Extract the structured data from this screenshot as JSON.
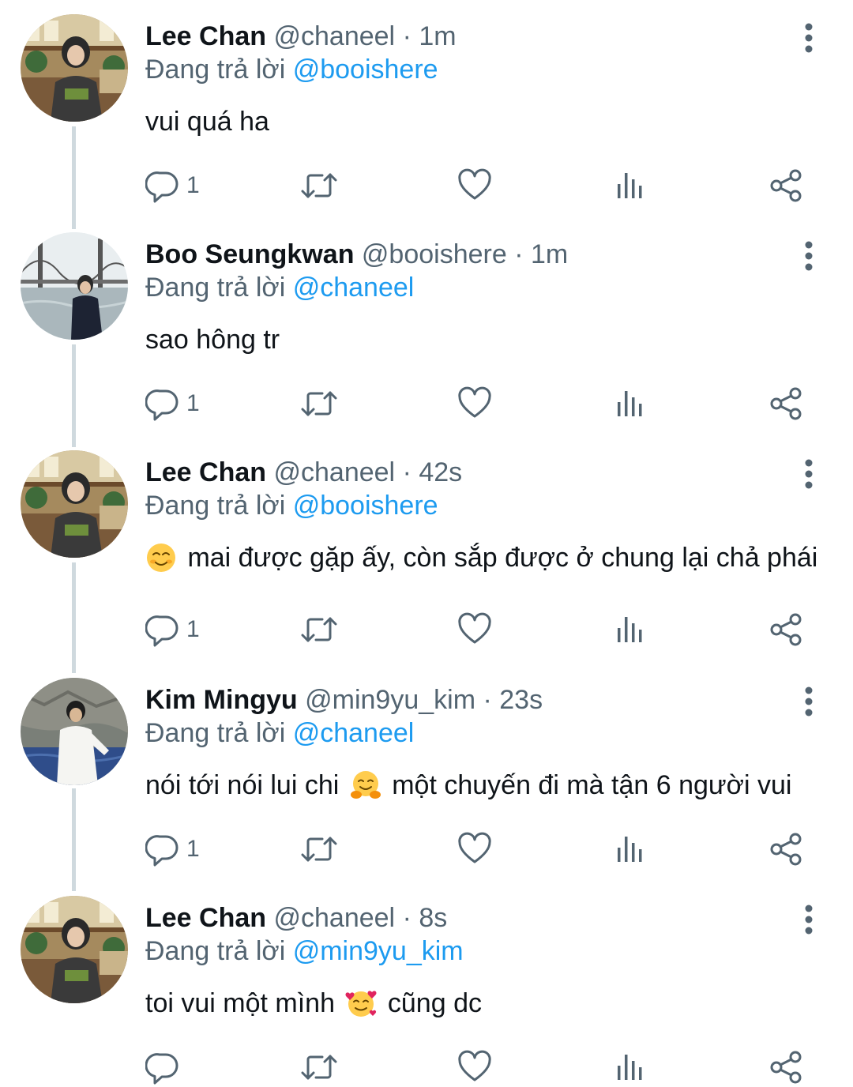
{
  "reply_prefix": "Đang trả lời",
  "separator": "·",
  "icons": {
    "reply": "reply-icon",
    "retweet": "retweet-icon",
    "like": "heart-icon",
    "stats": "stats-icon",
    "share": "share-icon",
    "more": "more-vertical-icon"
  },
  "colors": {
    "accent": "#1d9bf0",
    "secondary_text": "#536471",
    "thread_line": "#cfd9de"
  },
  "tweets": [
    {
      "name": "Lee Chan",
      "handle": "@chaneel",
      "time": "1m",
      "reply_to": "@booishere",
      "text_parts": [
        "vui quá ha"
      ],
      "reply_count": "1"
    },
    {
      "name": "Boo Seungkwan",
      "handle": "@booishere",
      "time": "1m",
      "reply_to": "@chaneel",
      "text_parts": [
        "sao hông tr"
      ],
      "reply_count": "1"
    },
    {
      "name": "Lee Chan",
      "handle": "@chaneel",
      "time": "42s",
      "reply_to": "@booishere",
      "emoji_lead": "smiling-face-icon",
      "text_parts": [
        "mai được gặp ấy, còn sắp được ở chung lại chả phái"
      ],
      "reply_count": "1"
    },
    {
      "name": "Kim Mingyu",
      "handle": "@min9yu_kim",
      "time": "23s",
      "reply_to": "@chaneel",
      "emoji_mid": "hugging-face-icon",
      "text_parts": [
        "nói tới nói lui chi",
        "một chuyến đi mà tận 6 người vui"
      ],
      "reply_count": "1"
    },
    {
      "name": "Lee Chan",
      "handle": "@chaneel",
      "time": "8s",
      "reply_to": "@min9yu_kim",
      "emoji_mid": "smiling-face-with-hearts-icon",
      "text_parts": [
        "toi vui một mình",
        "cũng dc"
      ],
      "reply_count": ""
    }
  ]
}
